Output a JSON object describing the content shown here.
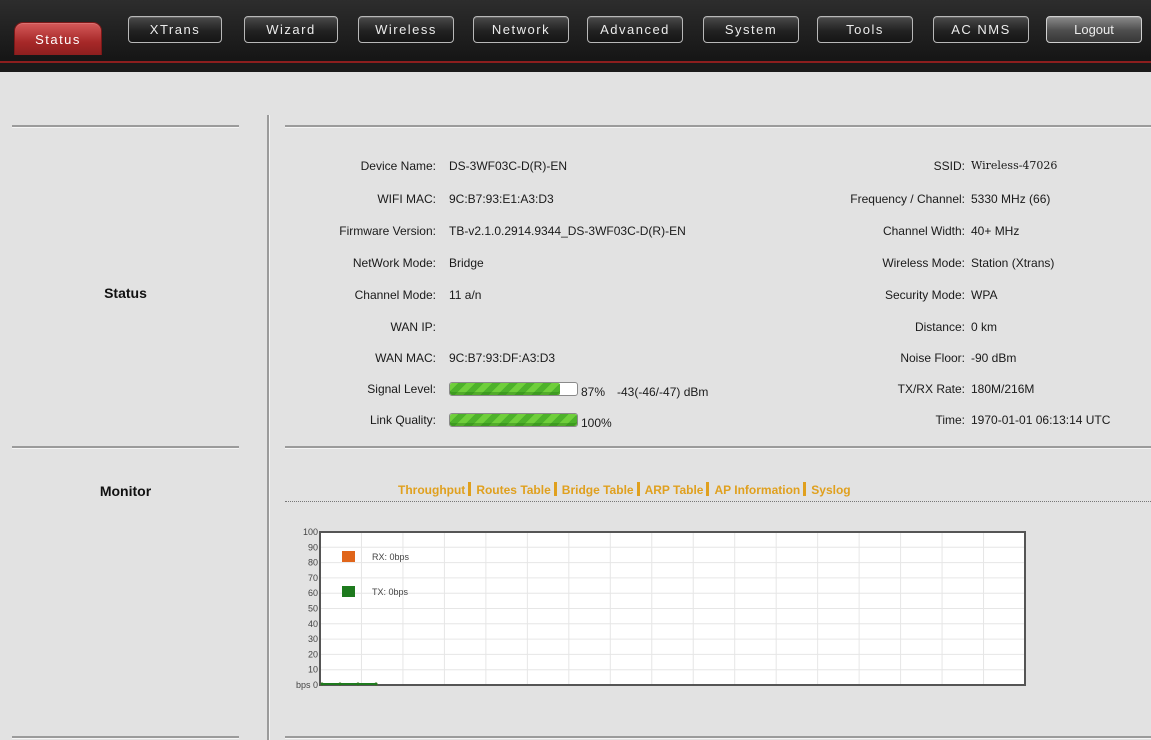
{
  "nav": {
    "tabs": [
      "Status",
      "XTrans",
      "Wizard",
      "Wireless",
      "Network",
      "Advanced",
      "System",
      "Tools",
      "AC NMS"
    ],
    "active_tab": "Status",
    "logout_label": "Logout",
    "accent_color": "#a62828"
  },
  "sections": {
    "status_label": "Status",
    "monitor_label": "Monitor"
  },
  "status": {
    "left": [
      {
        "label": "Device Name:",
        "value": "DS-3WF03C-D(R)-EN"
      },
      {
        "label": "WIFI MAC:",
        "value": "9C:B7:93:E1:A3:D3"
      },
      {
        "label": "Firmware Version:",
        "value": "TB-v2.1.0.2914.9344_DS-3WF03C-D(R)-EN"
      },
      {
        "label": "NetWork Mode:",
        "value": "Bridge"
      },
      {
        "label": "Channel Mode:",
        "value": "11 a/n"
      },
      {
        "label": "WAN IP:",
        "value": ""
      },
      {
        "label": "WAN MAC:",
        "value": "9C:B7:93:DF:A3:D3"
      }
    ],
    "signal": {
      "label": "Signal Level:",
      "percent": 87,
      "percent_text": "87%",
      "dbm_text": "-43(-46/-47) dBm"
    },
    "link": {
      "label": "Link Quality:",
      "percent": 100,
      "percent_text": "100%"
    },
    "right": [
      {
        "label": "SSID:",
        "value": "Wireless-47026"
      },
      {
        "label": "Frequency / Channel:",
        "value": "5330 MHz (66)"
      },
      {
        "label": "Channel Width:",
        "value": "40+ MHz"
      },
      {
        "label": "Wireless Mode:",
        "value": "Station (Xtrans)"
      },
      {
        "label": "Security Mode:",
        "value": "WPA"
      },
      {
        "label": "Distance:",
        "value": "0 km"
      },
      {
        "label": "Noise Floor:",
        "value": "-90 dBm"
      },
      {
        "label": "TX/RX Rate:",
        "value": "180M/216M"
      },
      {
        "label": "Time:",
        "value": "1970-01-01 06:13:14 UTC"
      }
    ]
  },
  "monitor": {
    "links": [
      "Throughput",
      "Routes Table",
      "Bridge Table",
      "ARP Table",
      "AP Information",
      "Syslog"
    ]
  },
  "chart_data": {
    "type": "line",
    "ylim": [
      0,
      100
    ],
    "y_ticks": [
      "100",
      "90",
      "80",
      "70",
      "60",
      "50",
      "40",
      "30",
      "20",
      "10",
      "bps 0"
    ],
    "grid": true,
    "legend_placement": "top-left",
    "series": [
      {
        "name": "RX: 0bps",
        "color": "#e0651a",
        "values": [
          0,
          0,
          0,
          0
        ]
      },
      {
        "name": "TX: 0bps",
        "color": "#1e7a1e",
        "values": [
          0,
          0,
          0,
          0
        ]
      }
    ]
  }
}
